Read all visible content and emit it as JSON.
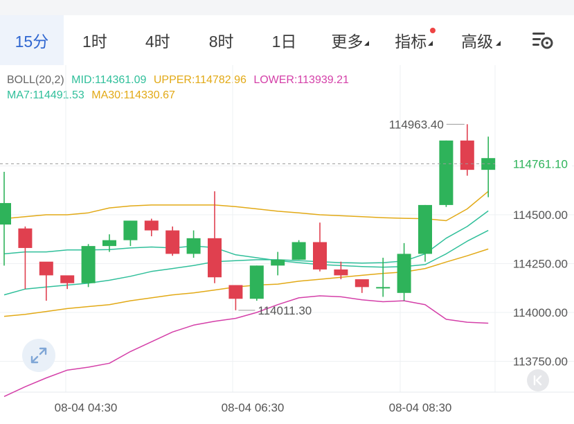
{
  "tabs": [
    {
      "label": "15分",
      "active": true
    },
    {
      "label": "1时"
    },
    {
      "label": "4时"
    },
    {
      "label": "8时"
    },
    {
      "label": "1日"
    },
    {
      "label": "更多",
      "dropdown": true
    },
    {
      "label": "指标",
      "dropdown": true,
      "badge": true
    },
    {
      "label": "高级",
      "dropdown": true
    }
  ],
  "settings_icon": "chart-settings-icon",
  "legend": {
    "boll_label": "BOLL(20,2)",
    "mid": "MID:114361.09",
    "upper": "UPPER:114782.96",
    "lower": "LOWER:113939.21",
    "ma7": "MA7:114491.53",
    "ma30": "MA30:114330.67"
  },
  "colors": {
    "up": "#2eb35a",
    "down": "#e0404f",
    "mid": "#2fbf9a",
    "upper": "#e2a915",
    "lower": "#d43fa8",
    "ma7": "#2fbf9a",
    "ma30": "#e2a915",
    "accent": "#2f66d0"
  },
  "chart_data": {
    "type": "candlestick",
    "y_ticks": [
      "114500.00",
      "114250.00",
      "114000.00",
      "113750.00"
    ],
    "x_ticks": [
      "08-04 04:30",
      "08-04 06:30",
      "08-04 08:30"
    ],
    "last_price": "114761.10",
    "max_label": "114963.40",
    "min_label": "114011.30",
    "ylim": [
      113580,
      115230
    ],
    "candles": [
      {
        "o": 114450,
        "h": 114720,
        "l": 114240,
        "c": 114560
      },
      {
        "o": 114430,
        "h": 114440,
        "l": 114120,
        "c": 114330
      },
      {
        "o": 114260,
        "h": 114255,
        "l": 114060,
        "c": 114190
      },
      {
        "o": 114190,
        "h": 114185,
        "l": 114120,
        "c": 114150
      },
      {
        "o": 114150,
        "h": 114350,
        "l": 114130,
        "c": 114340
      },
      {
        "o": 114340,
        "h": 114400,
        "l": 114310,
        "c": 114370
      },
      {
        "o": 114370,
        "h": 114470,
        "l": 114340,
        "c": 114470
      },
      {
        "o": 114470,
        "h": 114480,
        "l": 114390,
        "c": 114420
      },
      {
        "o": 114420,
        "h": 114440,
        "l": 114290,
        "c": 114300
      },
      {
        "o": 114300,
        "h": 114420,
        "l": 114280,
        "c": 114380
      },
      {
        "o": 114380,
        "h": 114620,
        "l": 114150,
        "c": 114180
      },
      {
        "o": 114140,
        "h": 114140,
        "l": 114011.3,
        "c": 114070
      },
      {
        "o": 114070,
        "h": 114240,
        "l": 114060,
        "c": 114240
      },
      {
        "o": 114240,
        "h": 114310,
        "l": 114190,
        "c": 114270
      },
      {
        "o": 114270,
        "h": 114370,
        "l": 114270,
        "c": 114360
      },
      {
        "o": 114360,
        "h": 114460,
        "l": 114210,
        "c": 114220
      },
      {
        "o": 114220,
        "h": 114260,
        "l": 114170,
        "c": 114190
      },
      {
        "o": 114170,
        "h": 114160,
        "l": 114100,
        "c": 114130
      },
      {
        "o": 114130,
        "h": 114280,
        "l": 114080,
        "c": 114130
      },
      {
        "o": 114100,
        "h": 114355,
        "l": 114060,
        "c": 114300
      },
      {
        "o": 114300,
        "h": 114550,
        "l": 114260,
        "c": 114550
      },
      {
        "o": 114550,
        "h": 114880,
        "l": 114540,
        "c": 114880
      },
      {
        "o": 114880,
        "h": 114963.4,
        "l": 114700,
        "c": 114730
      },
      {
        "o": 114730,
        "h": 114900,
        "l": 114590,
        "c": 114790
      }
    ],
    "series": [
      {
        "name": "UPPER",
        "values": [
          114480,
          114490,
          114500,
          114500,
          114510,
          114535,
          114545,
          114550,
          114550,
          114550,
          114550,
          114542,
          114530,
          114518,
          114510,
          114500,
          114495,
          114490,
          114485,
          114482,
          114480,
          114470,
          114530,
          114620
        ]
      },
      {
        "name": "MID",
        "values": [
          114300,
          114310,
          114310,
          114320,
          114320,
          114322,
          114330,
          114335,
          114330,
          114340,
          114332,
          114295,
          114280,
          114265,
          114255,
          114245,
          114240,
          114235,
          114232,
          114235,
          114245,
          114300,
          114365,
          114420
        ]
      },
      {
        "name": "LOWER",
        "values": [
          113570,
          113620,
          113665,
          113705,
          113720,
          113740,
          113800,
          113850,
          113900,
          113935,
          113955,
          113970,
          114000,
          114040,
          114075,
          114085,
          114080,
          114065,
          114055,
          114060,
          114040,
          113965,
          113950,
          113945
        ]
      },
      {
        "name": "MA7",
        "values": [
          114090,
          114120,
          114130,
          114140,
          114150,
          114165,
          114185,
          114210,
          114225,
          114240,
          114260,
          114265,
          114270,
          114270,
          114265,
          114260,
          114255,
          114253,
          114255,
          114263,
          114300,
          114380,
          114440,
          114520
        ]
      },
      {
        "name": "MA30",
        "values": [
          113980,
          113990,
          114005,
          114020,
          114030,
          114040,
          114060,
          114075,
          114090,
          114100,
          114115,
          114130,
          114140,
          114145,
          114160,
          114170,
          114180,
          114190,
          114200,
          114207,
          114225,
          114258,
          114290,
          114325
        ]
      }
    ]
  }
}
